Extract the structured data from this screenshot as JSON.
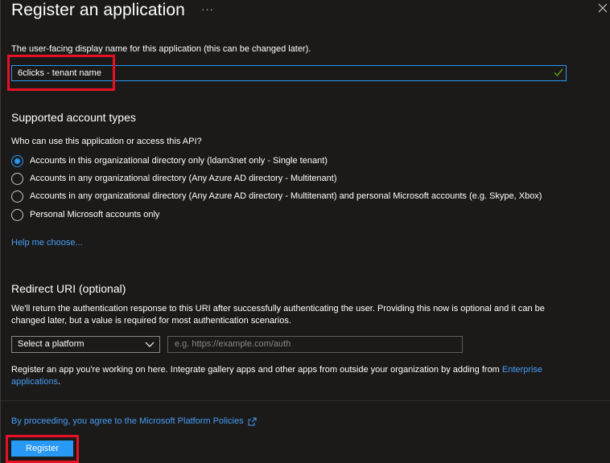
{
  "header": {
    "title": "Register an application",
    "more_icon": "more-horizontal-icon",
    "close_icon": "close-icon"
  },
  "name": {
    "description": "The user-facing display name for this application (this can be changed later).",
    "value": "6clicks - tenant name",
    "valid_icon": "checkmark-icon"
  },
  "account_types": {
    "title": "Supported account types",
    "question": "Who can use this application or access this API?",
    "options": [
      {
        "label": "Accounts in this organizational directory only (ldam3net only - Single tenant)",
        "selected": true
      },
      {
        "label": "Accounts in any organizational directory (Any Azure AD directory - Multitenant)",
        "selected": false
      },
      {
        "label": "Accounts in any organizational directory (Any Azure AD directory - Multitenant) and personal Microsoft accounts (e.g. Skype, Xbox)",
        "selected": false
      },
      {
        "label": "Personal Microsoft accounts only",
        "selected": false
      }
    ],
    "help_link": "Help me choose..."
  },
  "redirect": {
    "title": "Redirect URI (optional)",
    "description": "We'll return the authentication response to this URI after successfully authenticating the user. Providing this now is optional and it can be changed later, but a value is required for most authentication scenarios.",
    "platform_select": "Select a platform",
    "uri_placeholder": "e.g. https://example.com/auth"
  },
  "gallery_note": {
    "text": "Register an app you're working on here. Integrate gallery apps and other apps from outside your organization by adding from ",
    "link": "Enterprise applications",
    "suffix": "."
  },
  "footer": {
    "policy_link": "By proceeding, you agree to the Microsoft Platform Policies",
    "policy_icon": "external-link-icon",
    "register_label": "Register"
  },
  "colors": {
    "background": "#1b1a19",
    "accent": "#2899f5",
    "link": "#479ef5",
    "highlight": "#e81123",
    "valid": "#57a300"
  }
}
